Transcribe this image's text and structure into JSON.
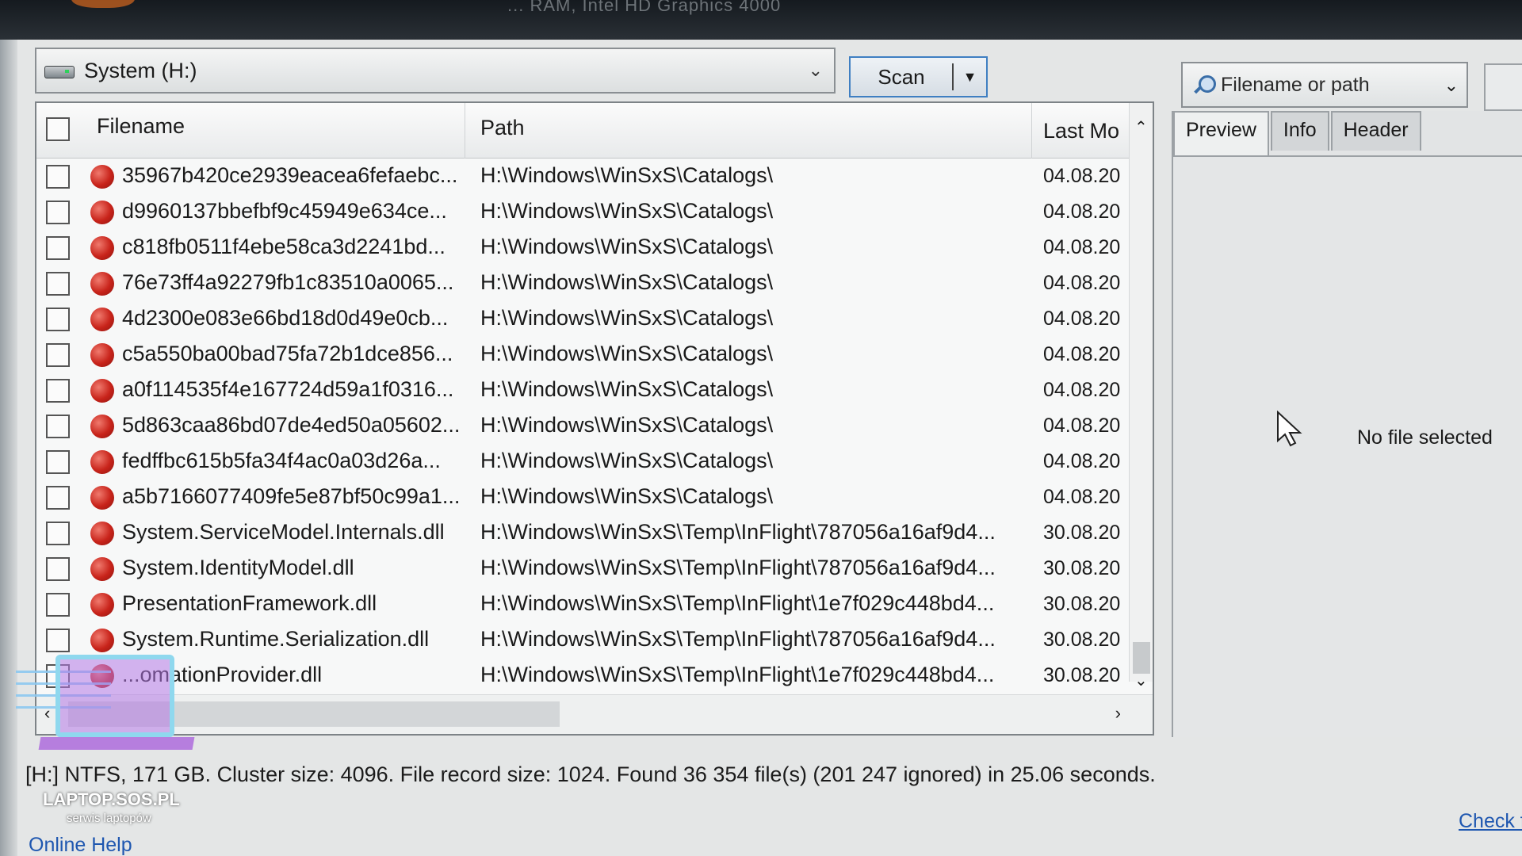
{
  "window": {
    "title": "... RAM, Intel HD Graphics 4000"
  },
  "drive_select": {
    "label": "System (H:)"
  },
  "scan_button": {
    "label": "Scan"
  },
  "search": {
    "placeholder": "Filename or path"
  },
  "table": {
    "columns": {
      "filename": "Filename",
      "path": "Path",
      "last_modified": "Last Mo"
    },
    "rows": [
      {
        "filename": "35967b420ce2939eacea6fefaebc...",
        "path": "H:\\Windows\\WinSxS\\Catalogs\\",
        "date": "04.08.20"
      },
      {
        "filename": "d9960137bbefbf9c45949e634ce...",
        "path": "H:\\Windows\\WinSxS\\Catalogs\\",
        "date": "04.08.20"
      },
      {
        "filename": "c818fb0511f4ebe58ca3d2241bd...",
        "path": "H:\\Windows\\WinSxS\\Catalogs\\",
        "date": "04.08.20"
      },
      {
        "filename": "76e73ff4a92279fb1c83510a0065...",
        "path": "H:\\Windows\\WinSxS\\Catalogs\\",
        "date": "04.08.20"
      },
      {
        "filename": "4d2300e083e66bd18d0d49e0cb...",
        "path": "H:\\Windows\\WinSxS\\Catalogs\\",
        "date": "04.08.20"
      },
      {
        "filename": "c5a550ba00bad75fa72b1dce856...",
        "path": "H:\\Windows\\WinSxS\\Catalogs\\",
        "date": "04.08.20"
      },
      {
        "filename": "a0f114535f4e167724d59a1f0316...",
        "path": "H:\\Windows\\WinSxS\\Catalogs\\",
        "date": "04.08.20"
      },
      {
        "filename": "5d863caa86bd07de4ed50a05602...",
        "path": "H:\\Windows\\WinSxS\\Catalogs\\",
        "date": "04.08.20"
      },
      {
        "filename": "fedffbc615b5fa34f4ac0a03d26a...",
        "path": "H:\\Windows\\WinSxS\\Catalogs\\",
        "date": "04.08.20"
      },
      {
        "filename": "a5b7166077409fe5e87bf50c99a1...",
        "path": "H:\\Windows\\WinSxS\\Catalogs\\",
        "date": "04.08.20"
      },
      {
        "filename": "System.ServiceModel.Internals.dll",
        "path": "H:\\Windows\\WinSxS\\Temp\\InFlight\\787056a16af9d4...",
        "date": "30.08.20"
      },
      {
        "filename": "System.IdentityModel.dll",
        "path": "H:\\Windows\\WinSxS\\Temp\\InFlight\\787056a16af9d4...",
        "date": "30.08.20"
      },
      {
        "filename": "PresentationFramework.dll",
        "path": "H:\\Windows\\WinSxS\\Temp\\InFlight\\1e7f029c448bd4...",
        "date": "30.08.20"
      },
      {
        "filename": "System.Runtime.Serialization.dll",
        "path": "H:\\Windows\\WinSxS\\Temp\\InFlight\\787056a16af9d4...",
        "date": "30.08.20"
      },
      {
        "filename": "...omationProvider.dll",
        "path": "H:\\Windows\\WinSxS\\Temp\\InFlight\\1e7f029c448bd4...",
        "date": "30.08.20"
      }
    ]
  },
  "preview": {
    "tabs": [
      "Preview",
      "Info",
      "Header"
    ],
    "active_tab": "Preview",
    "empty_text": "No file selected"
  },
  "status": {
    "text": "[H:] NTFS, 171 GB. Cluster size: 4096. File record size: 1024. Found 36 354 file(s) (201 247 ignored) in 25.06 seconds."
  },
  "links": {
    "online_help": "Online Help",
    "check": "Check f"
  },
  "watermark": {
    "brand": "LAPTOP.SOS.PL",
    "tagline": "serwis laptopów"
  },
  "icons": {
    "file_status": "red-circle-icon",
    "drive": "hard-drive-icon",
    "search": "magnifier-icon",
    "cursor": "mouse-pointer-icon"
  },
  "colors": {
    "accent_border": "#3f7fc2",
    "file_status_red": "#c8231a",
    "link_blue": "#1f57b0"
  }
}
